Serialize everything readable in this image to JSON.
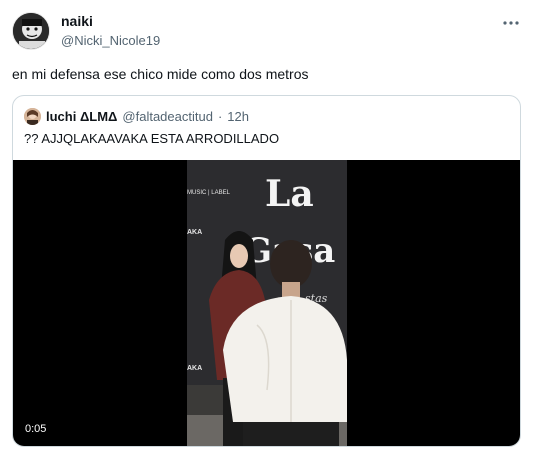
{
  "tweet": {
    "author_name": "naiki",
    "author_handle": "@Nicki_Nicole19",
    "text": "en mi defensa ese chico mide como dos metros"
  },
  "quote": {
    "author_name": "luchi ΔLMΔ",
    "author_handle": "@faltadeactitud",
    "separator": "·",
    "time": "12h",
    "text": "?? AJJQLAKAAVAKA ESTA ARRODILLADO",
    "video": {
      "duration": "0:05",
      "backdrop_text": [
        "La",
        "Gasa",
        "MUSIC | LABEL",
        "AKA",
        "AKA"
      ]
    }
  },
  "colors": {
    "text_primary": "#0f1419",
    "text_secondary": "#536471",
    "border": "#cfd9de"
  }
}
